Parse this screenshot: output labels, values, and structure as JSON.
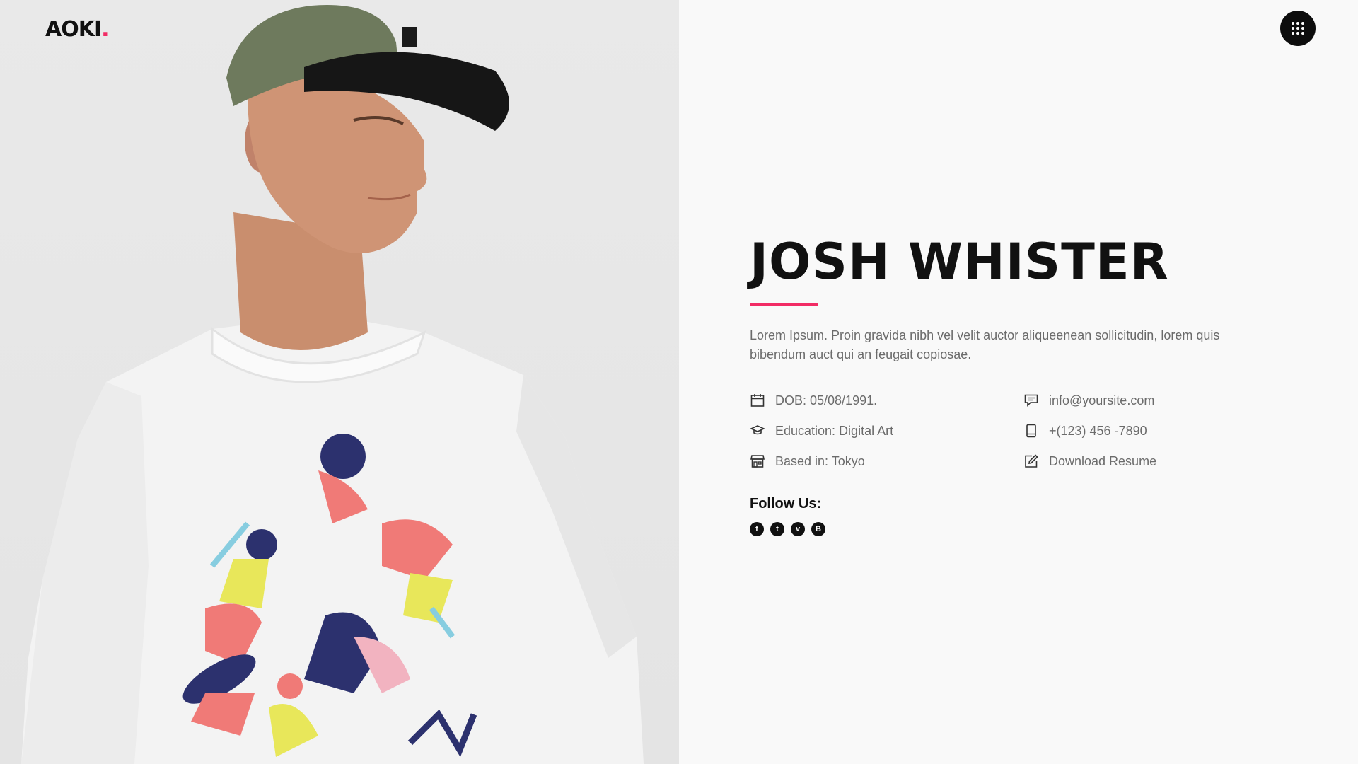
{
  "brand": {
    "logo_text": "AOKI",
    "logo_dot": ".",
    "accent": "#f22c65"
  },
  "header": {
    "menu_icon": "grid-menu-icon"
  },
  "profile": {
    "name": "JOSH WHISTER",
    "bio": "Lorem Ipsum. Proin gravida nibh vel velit auctor aliqueenean sollicitudin, lorem quis bibendum auct qui an feugait copiosae.",
    "details": {
      "dob": "DOB: 05/08/1991.",
      "education": "Education: Digital Art",
      "based": "Based in: Tokyo",
      "email": "info@yoursite.com",
      "phone": "+(123) 456 -7890",
      "resume": "Download Resume"
    },
    "icons": {
      "dob": "calendar-icon",
      "education": "graduation-cap-icon",
      "based": "storefront-icon",
      "email": "chat-icon",
      "phone": "tablet-icon",
      "resume": "edit-icon"
    },
    "follow_title": "Follow Us:",
    "socials": [
      {
        "name": "facebook-icon",
        "glyph": "f"
      },
      {
        "name": "twitter-icon",
        "glyph": "t"
      },
      {
        "name": "vimeo-icon",
        "glyph": "v"
      },
      {
        "name": "blogger-icon",
        "glyph": "B"
      }
    ]
  }
}
